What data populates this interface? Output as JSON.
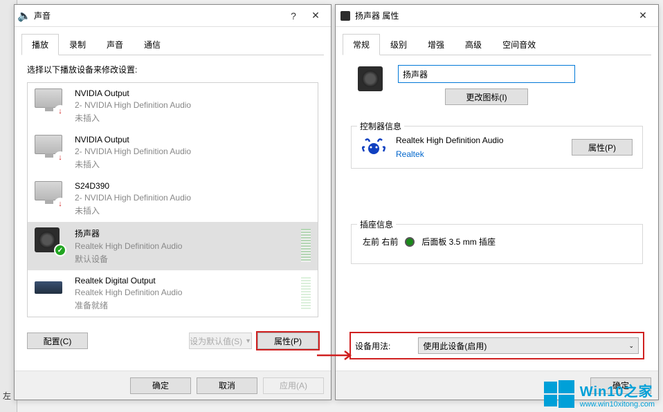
{
  "bg_partial_text": "左",
  "sound_dialog": {
    "title": "声音",
    "tabs": [
      "播放",
      "录制",
      "声音",
      "通信"
    ],
    "instruction": "选择以下播放设备来修改设置:",
    "devices": [
      {
        "name": "NVIDIA Output",
        "desc": "2- NVIDIA High Definition Audio",
        "status": "未插入",
        "badge": "red"
      },
      {
        "name": "NVIDIA Output",
        "desc": "2- NVIDIA High Definition Audio",
        "status": "未插入",
        "badge": "red"
      },
      {
        "name": "S24D390",
        "desc": "2- NVIDIA High Definition Audio",
        "status": "未插入",
        "badge": "red"
      },
      {
        "name": "扬声器",
        "desc": "Realtek High Definition Audio",
        "status": "默认设备",
        "badge": "green"
      },
      {
        "name": "Realtek Digital Output",
        "desc": "Realtek High Definition Audio",
        "status": "准备就绪",
        "badge": ""
      }
    ],
    "configure_label": "配置(C)",
    "set_default_label": "设为默认值(S)",
    "properties_label": "属性(P)",
    "ok_label": "确定",
    "cancel_label": "取消",
    "apply_label": "应用(A)"
  },
  "prop_dialog": {
    "title": "扬声器 属性",
    "tabs": [
      "常规",
      "级别",
      "增强",
      "高级",
      "空间音效"
    ],
    "name_value": "扬声器",
    "change_icon_label": "更改图标(I)",
    "controller_legend": "控制器信息",
    "controller_name": "Realtek High Definition Audio",
    "controller_vendor": "Realtek",
    "controller_props_label": "属性(P)",
    "jack_legend": "插座信息",
    "jack_lr": "左前 右前",
    "jack_desc": "后面板 3.5 mm 插座",
    "usage_label": "设备用法:",
    "usage_value": "使用此设备(启用)",
    "ok_label": "确定"
  },
  "wm": {
    "title": "Win10之家",
    "url": "www.win10xitong.com"
  }
}
